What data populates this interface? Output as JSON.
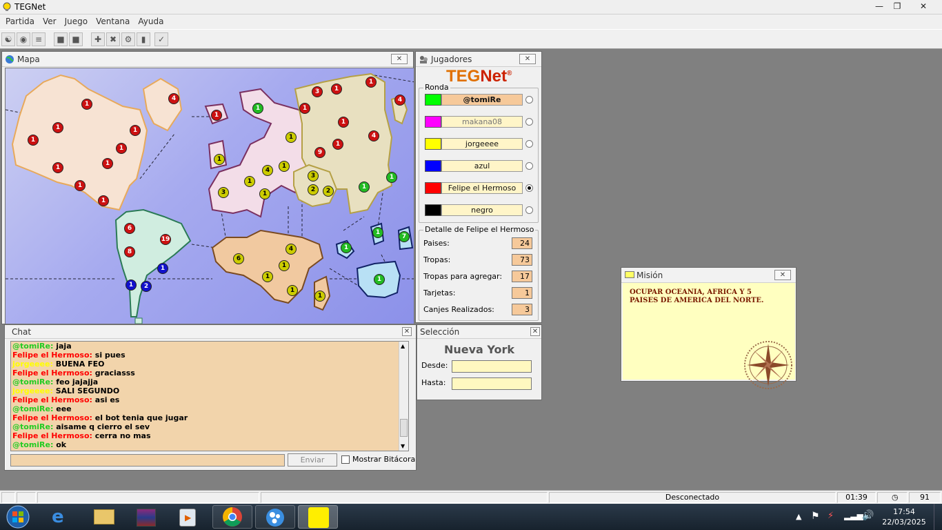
{
  "window": {
    "title": "TEGNet"
  },
  "menu": [
    "Partida",
    "Ver",
    "Juego",
    "Ventana",
    "Ayuda"
  ],
  "toolbar_icons": [
    "connect-icon",
    "start-icon",
    "list-icon",
    "square-icon",
    "square2-icon",
    "plus-icon",
    "cross-icon",
    "gear-icon",
    "cards-icon",
    "check-icon"
  ],
  "map_window": {
    "title": "Mapa",
    "armies": [
      {
        "n": "1",
        "c": "#cc1111"
      },
      {
        "n": "4",
        "c": "#cc1111"
      },
      {
        "n": "1",
        "c": "#cc1111"
      },
      {
        "n": "1",
        "c": "#cc1111"
      },
      {
        "n": "1",
        "c": "#cc1111"
      },
      {
        "n": "1",
        "c": "#cc1111"
      },
      {
        "n": "1",
        "c": "#cc1111"
      },
      {
        "n": "1",
        "c": "#cc1111"
      },
      {
        "n": "1",
        "c": "#cc1111"
      },
      {
        "n": "1",
        "c": "#cc1111"
      },
      {
        "n": "1",
        "c": "#cc1111"
      },
      {
        "n": "1",
        "c": "#22bb22"
      },
      {
        "n": "3",
        "c": "#cc1111"
      },
      {
        "n": "1",
        "c": "#cc1111"
      },
      {
        "n": "1",
        "c": "#cc1111"
      },
      {
        "n": "1",
        "c": "#cc1111"
      },
      {
        "n": "4",
        "c": "#cc1111"
      },
      {
        "n": "1",
        "c": "#cc1111"
      },
      {
        "n": "1",
        "c": "#cc1111"
      },
      {
        "n": "4",
        "c": "#cc1111"
      },
      {
        "n": "9",
        "c": "#cc1111"
      },
      {
        "n": "1",
        "c": "#cccc00"
      },
      {
        "n": "1",
        "c": "#cccc00"
      },
      {
        "n": "4",
        "c": "#cccc00"
      },
      {
        "n": "1",
        "c": "#cccc00"
      },
      {
        "n": "3",
        "c": "#cccc00"
      },
      {
        "n": "1",
        "c": "#cccc00"
      },
      {
        "n": "3",
        "c": "#cccc00"
      },
      {
        "n": "2",
        "c": "#cccc00"
      },
      {
        "n": "2",
        "c": "#cccc00"
      },
      {
        "n": "1",
        "c": "#cccc00"
      },
      {
        "n": "1",
        "c": "#22bb22"
      },
      {
        "n": "1",
        "c": "#22bb22"
      },
      {
        "n": "6",
        "c": "#cc1111"
      },
      {
        "n": "19",
        "c": "#cc1111"
      },
      {
        "n": "8",
        "c": "#cc1111"
      },
      {
        "n": "1",
        "c": "#1111cc"
      },
      {
        "n": "1",
        "c": "#1111cc"
      },
      {
        "n": "2",
        "c": "#1111cc"
      },
      {
        "n": "6",
        "c": "#cccc00"
      },
      {
        "n": "4",
        "c": "#cccc00"
      },
      {
        "n": "1",
        "c": "#cccc00"
      },
      {
        "n": "1",
        "c": "#cccc00"
      },
      {
        "n": "1",
        "c": "#cccc00"
      },
      {
        "n": "1",
        "c": "#cccc00"
      },
      {
        "n": "1",
        "c": "#22bb22"
      },
      {
        "n": "1",
        "c": "#22bb22"
      },
      {
        "n": "7",
        "c": "#22bb22"
      },
      {
        "n": "1",
        "c": "#22bb22"
      }
    ]
  },
  "players_window": {
    "title": "Jugadores",
    "logo_left": "TEG",
    "logo_right": "Net",
    "logo_mark": "®",
    "round_label": "Ronda",
    "players": [
      {
        "name": "@tomiRe",
        "color": "#00ff00",
        "active": true
      },
      {
        "name": "makana08",
        "color": "#ff00ff",
        "active": false
      },
      {
        "name": "jorgeeee",
        "color": "#ffff00",
        "active": false
      },
      {
        "name": "azul",
        "color": "#0000ff",
        "active": false
      },
      {
        "name": "Felipe el Hermoso",
        "color": "#ff0000",
        "active": false
      },
      {
        "name": "negro",
        "color": "#000000",
        "active": false
      }
    ],
    "detail_label": "Detalle de Felipe el Hermoso",
    "details": [
      {
        "k": "Paises:",
        "v": "24"
      },
      {
        "k": "Tropas:",
        "v": "73"
      },
      {
        "k": "Tropas para agregar:",
        "v": "17"
      },
      {
        "k": "Tarjetas:",
        "v": "1"
      },
      {
        "k": "Canjes Realizados:",
        "v": "3"
      }
    ]
  },
  "chat_window": {
    "title": "Chat",
    "lines": [
      {
        "who": "@tomiRe:",
        "msg": "jaja",
        "c": "#22cc22"
      },
      {
        "who": "Felipe el Hermoso:",
        "msg": "si pues",
        "c": "#ff0000"
      },
      {
        "who": "jorgeeee:",
        "msg": "BUENA FEO",
        "c": "#ffff00"
      },
      {
        "who": "Felipe el Hermoso:",
        "msg": "graciasss",
        "c": "#ff0000"
      },
      {
        "who": "@tomiRe:",
        "msg": "feo jajajja",
        "c": "#22cc22"
      },
      {
        "who": "jorgeeee:",
        "msg": "SALI SEGUNDO",
        "c": "#ffff00"
      },
      {
        "who": "Felipe el Hermoso:",
        "msg": "asi es",
        "c": "#ff0000"
      },
      {
        "who": "@tomiRe:",
        "msg": "eee",
        "c": "#22cc22"
      },
      {
        "who": "Felipe el Hermoso:",
        "msg": "el bot tenia que jugar",
        "c": "#ff0000"
      },
      {
        "who": "@tomiRe:",
        "msg": "aisame q cierro el sev",
        "c": "#22cc22"
      },
      {
        "who": "Felipe el Hermoso:",
        "msg": "cerra no mas",
        "c": "#ff0000"
      },
      {
        "who": "@tomiRe:",
        "msg": "ok",
        "c": "#22cc22"
      }
    ],
    "send_label": "Enviar",
    "log_label": "Mostrar Bitácora"
  },
  "selection_window": {
    "title": "Selección",
    "country": "Nueva York",
    "from_label": "Desde:",
    "to_label": "Hasta:"
  },
  "mission_window": {
    "title": "Misión",
    "text": "OCUPAR OCEANIA, AFRICA Y 5 PAISES DE AMERICA DEL NORTE."
  },
  "status": {
    "connection": "Desconectado",
    "timer": "01:39",
    "count": "91"
  },
  "tray": {
    "time": "17:54",
    "date": "22/03/2025"
  },
  "colors": {
    "accent": "#cc4400"
  }
}
